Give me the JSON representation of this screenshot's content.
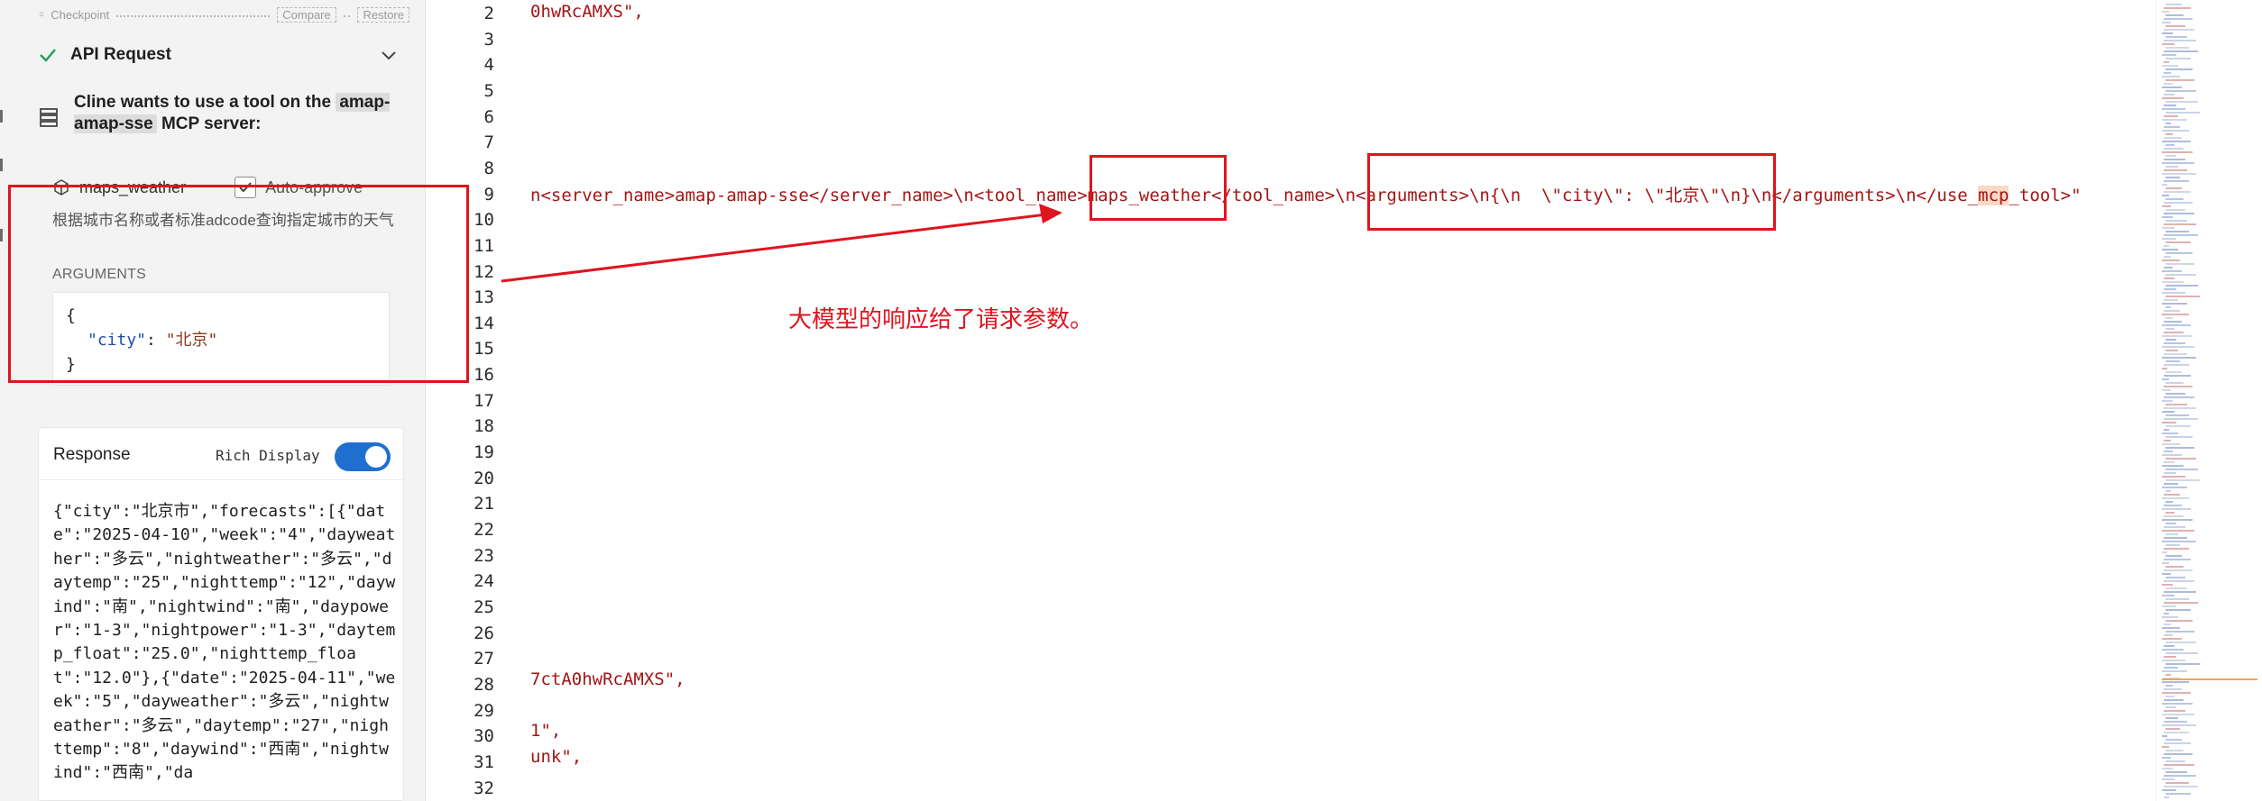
{
  "cline": {
    "checkpoint": {
      "label": "Checkpoint",
      "compare": "Compare",
      "restore": "Restore"
    },
    "api_request": {
      "title": "API Request",
      "status_icon": "check-icon",
      "collapse_icon": "chevron-down-icon"
    },
    "tool_use": {
      "icon": "server-icon",
      "prefix": "Cline wants to use a tool on the",
      "server": "amap-amap-sse",
      "suffix": "MCP server:",
      "tool_icon": "package-icon",
      "tool_name": "maps_weather",
      "auto_approve_label": "Auto-approve",
      "auto_approve_checked": true,
      "description": "根据城市名称或者标准adcode查询指定城市的天气",
      "arguments_label": "ARGUMENTS",
      "arguments": {
        "open": "{",
        "key": "\"city\"",
        "sep": ": ",
        "value": "\"北京\"",
        "close": "}"
      }
    },
    "response": {
      "title": "Response",
      "rich_display_label": "Rich Display",
      "rich_display_on": true,
      "body": "{\"city\":\"北京市\",\"forecasts\":[{\"date\":\"2025-04-10\",\"week\":\"4\",\"dayweather\":\"多云\",\"nightweather\":\"多云\",\"daytemp\":\"25\",\"nighttemp\":\"12\",\"daywind\":\"南\",\"nightwind\":\"南\",\"daypower\":\"1-3\",\"nightpower\":\"1-3\",\"daytemp_float\":\"25.0\",\"nighttemp_float\":\"12.0\"},{\"date\":\"2025-04-11\",\"week\":\"5\",\"dayweather\":\"多云\",\"nightweather\":\"多云\",\"daytemp\":\"27\",\"nighttemp\":\"8\",\"daywind\":\"西南\",\"nightwind\":\"西南\",\"da"
    }
  },
  "editor": {
    "line_numbers": [
      "2",
      "3",
      "4",
      "5",
      "6",
      "7",
      "8",
      "9",
      "10",
      "11",
      "12",
      "13",
      "14",
      "15",
      "16",
      "17",
      "18",
      "19",
      "20",
      "21",
      "22",
      "23",
      "24",
      "25",
      "26",
      "27",
      "28",
      "29",
      "30",
      "31",
      "32"
    ],
    "code": {
      "line2": "0hwRcAMXS\",",
      "line9_a": "n<server_name>amap-amap-sse</server_name>\\n<tool_name>maps_weather</tool_name>\\n<arguments>\\n{\\n  \\\"city\\\": \\\"北京\\\"\\n}\\n</arguments>\\n</use_",
      "line9_hl": "mcp",
      "line9_b": "_tool>\"",
      "line28": "7ctA0hwRcAMXS\",",
      "line30": "1\",",
      "line31": "unk\","
    },
    "annotation": "大模型的响应给了请求参数。",
    "annotation_color": "#e0141e"
  }
}
